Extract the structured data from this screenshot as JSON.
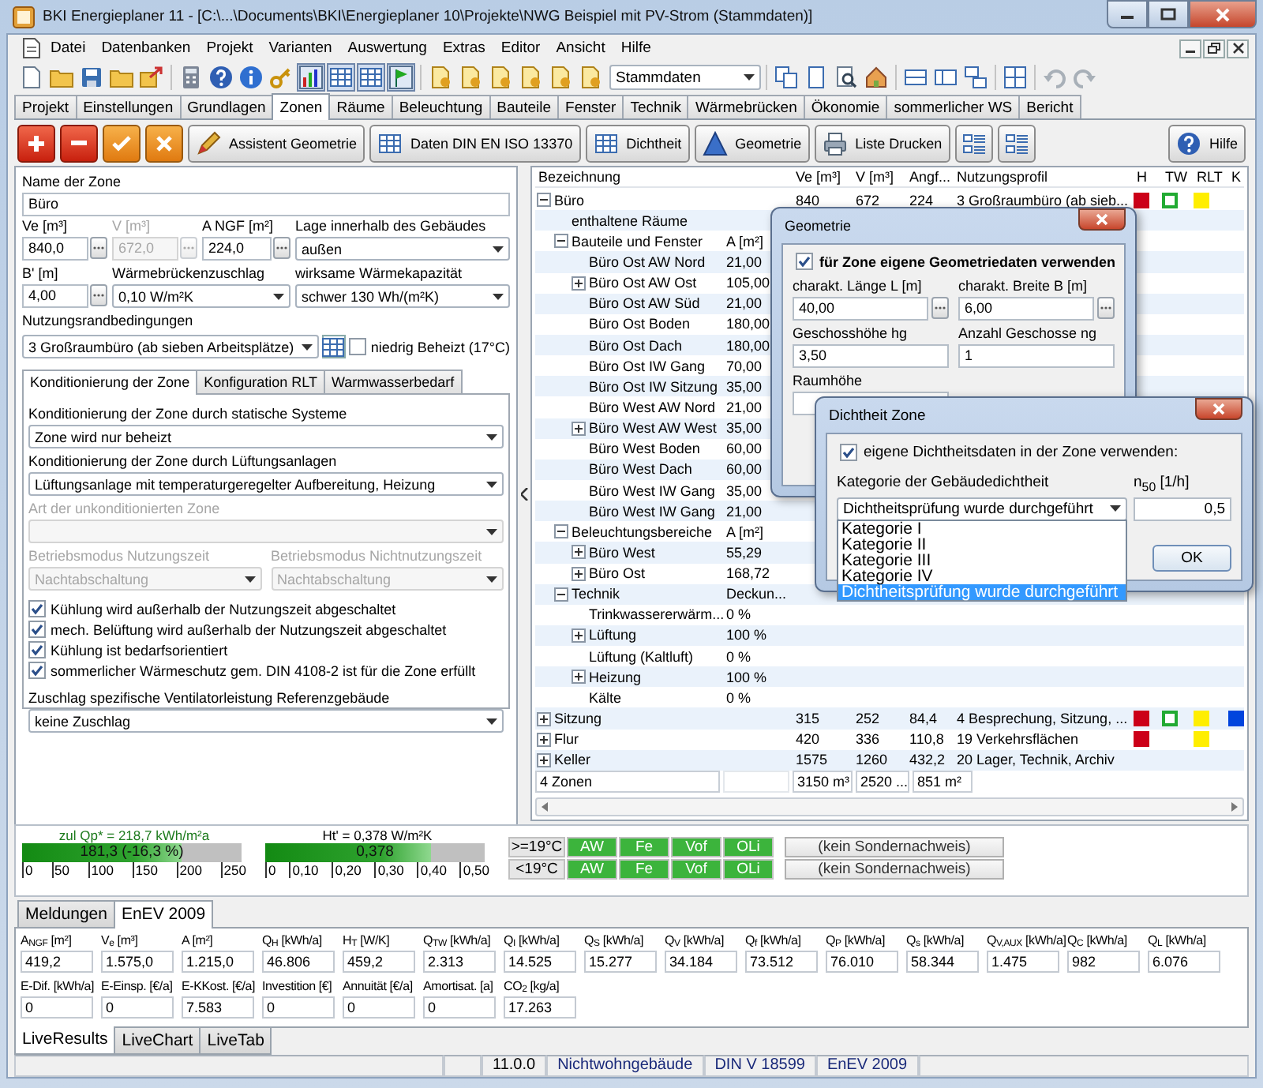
{
  "window": {
    "title": "BKI Energieplaner 11 - [C:\\...\\Documents\\BKI\\Energieplaner 10\\Projekte\\NWG Beispiel mit PV-Strom (Stammdaten)]"
  },
  "menu": [
    "Datei",
    "Datenbanken",
    "Projekt",
    "Varianten",
    "Auswertung",
    "Extras",
    "Editor",
    "Ansicht",
    "Hilfe"
  ],
  "toolbar": {
    "variant_select": "Stammdaten"
  },
  "tabs": [
    {
      "label": "Projekt",
      "selected": false
    },
    {
      "label": "Einstellungen",
      "selected": false
    },
    {
      "label": "Grundlagen",
      "selected": false
    },
    {
      "label": "Zonen",
      "selected": true
    },
    {
      "label": "Räume",
      "selected": false
    },
    {
      "label": "Beleuchtung",
      "selected": false
    },
    {
      "label": "Bauteile",
      "selected": false
    },
    {
      "label": "Fenster",
      "selected": false
    },
    {
      "label": "Technik",
      "selected": false
    },
    {
      "label": "Wärmebrücken",
      "selected": false
    },
    {
      "label": "Ökonomie",
      "selected": false
    },
    {
      "label": "sommerlicher WS",
      "selected": false
    },
    {
      "label": "Bericht",
      "selected": false
    }
  ],
  "zone_toolbar": [
    {
      "kind": "add"
    },
    {
      "kind": "remove"
    },
    {
      "kind": "accept"
    },
    {
      "kind": "cancel"
    },
    {
      "kind": "wizard",
      "label": "Assistent Geometrie"
    },
    {
      "kind": "table",
      "label": "Daten DIN EN ISO 13370"
    },
    {
      "kind": "table",
      "label": "Dichtheit"
    },
    {
      "kind": "shape",
      "label": "Geometrie"
    },
    {
      "kind": "print",
      "label": "Liste Drucken"
    },
    {
      "kind": "list"
    },
    {
      "kind": "list"
    },
    {
      "kind": "help",
      "label": "Hilfe"
    }
  ],
  "zone_form": {
    "name": {
      "label": "Name der Zone",
      "value": "Büro"
    },
    "row_a": [
      {
        "label": "Ve [m³]",
        "value": "840,0",
        "kind": "number",
        "disabled": false
      },
      {
        "label": "V [m³]",
        "value": "672,0",
        "kind": "number",
        "disabled": true
      },
      {
        "label": "A NGF [m²]",
        "value": "224,0",
        "kind": "number",
        "disabled": false
      },
      {
        "label": "Lage innerhalb des Gebäudes",
        "value": "außen",
        "kind": "select",
        "disabled": false
      }
    ],
    "row_b": [
      {
        "label": "B' [m]",
        "value": "4,00",
        "kind": "number",
        "disabled": false
      },
      {
        "label": "Wärmebrückenzuschlag",
        "value": "0,10 W/m²K",
        "kind": "select",
        "disabled": false
      },
      {
        "label": "wirksame Wärmekapazität",
        "value": "schwer 130 Wh/(m²K)",
        "kind": "select",
        "disabled": false
      }
    ],
    "usage": {
      "label": "Nutzungsrandbedingungen",
      "value": "3 Großraumbüro (ab sieben Arbeitsplätze)",
      "low_heat": {
        "label": "niedrig Beheizt (17°C)",
        "checked": false
      }
    },
    "subtabs": [
      {
        "label": "Konditionierung der Zone",
        "selected": true
      },
      {
        "label": "Konfiguration RLT",
        "selected": false
      },
      {
        "label": "Warmwasserbedarf",
        "selected": false
      }
    ],
    "conditioning": [
      {
        "kind": "select",
        "label": "Konditionierung der Zone durch statische Systeme",
        "value": "Zone wird nur beheizt",
        "disabled": false
      },
      {
        "kind": "select",
        "label": "Konditionierung der Zone durch Lüftungsanlagen",
        "value": "Lüftungsanlage mit temperaturgeregelter Aufbereitung, Heizung",
        "disabled": false
      },
      {
        "kind": "select",
        "label": "Art der unkonditionierten Zone",
        "disabled": true
      },
      {
        "kind": "pair",
        "items": [
          {
            "label": "Betriebsmodus Nutzungszeit",
            "value": "Nachtabschaltung",
            "disabled": true
          },
          {
            "label": "Betriebsmodus Nichtnutzungszeit",
            "value": "Nachtabschaltung",
            "disabled": true
          }
        ]
      },
      {
        "kind": "checkbox",
        "label": "Kühlung wird außerhalb der Nutzungszeit abgeschaltet",
        "checked": true
      },
      {
        "kind": "checkbox",
        "label": "mech. Belüftung wird außerhalb der Nutzungszeit abgeschaltet",
        "checked": true
      },
      {
        "kind": "checkbox",
        "label": "Kühlung ist bedarfsorientiert",
        "checked": true
      },
      {
        "kind": "checkbox",
        "label": "sommerlicher Wärmeschutz gem. DIN 4108-2 ist für die Zone erfüllt",
        "checked": true
      },
      {
        "kind": "select",
        "label": "Zuschlag spezifische Ventilatorleistung Referenzgebäude",
        "value": "keine Zuschlag",
        "disabled": false
      }
    ]
  },
  "tree": {
    "columns": [
      {
        "title": "Bezeichnung",
        "kind": "label"
      },
      {
        "kind": "text"
      },
      {
        "title": "Ve [m³]",
        "kind": "text"
      },
      {
        "title": "V [m³]",
        "kind": "text"
      },
      {
        "title": "Angf...",
        "kind": "text"
      },
      {
        "title": "Nutzungsprofil",
        "kind": "text"
      },
      {
        "title": "H",
        "kind": "marker"
      },
      {
        "title": "TW",
        "kind": "marker"
      },
      {
        "title": "RLT",
        "kind": "marker"
      },
      {
        "title": "K",
        "kind": "marker"
      }
    ],
    "rows": [
      {
        "expanded": true,
        "cells": [
          "Büro",
          "",
          "840",
          "672",
          "224",
          "3 Großraumbüro (ab sieb..."
        ],
        "markers": {
          "h": {
            "color": "#cc0018",
            "kind": "solid"
          },
          "tw": {
            "color": "#22aa33",
            "kind": "hollow"
          },
          "rlt": {
            "color": "#ffee00",
            "kind": "solid"
          }
        },
        "children": [
          {
            "cells": [
              "enthaltene Räume"
            ]
          },
          {
            "cells": [
              "Bauteile und Fenster",
              "A [m²]"
            ],
            "expanded": true,
            "children": [
              {
                "cells": [
                  "Büro Ost AW Nord",
                  "21,00"
                ]
              },
              {
                "cells": [
                  "Büro Ost AW Ost",
                  "105,00"
                ],
                "expanded": false
              },
              {
                "cells": [
                  "Büro Ost AW Süd",
                  "21,00"
                ]
              },
              {
                "cells": [
                  "Büro Ost Boden",
                  "180,00"
                ]
              },
              {
                "cells": [
                  "Büro Ost Dach",
                  "180,00"
                ]
              },
              {
                "cells": [
                  "Büro Ost IW Gang",
                  "70,00"
                ]
              },
              {
                "cells": [
                  "Büro Ost IW Sitzung",
                  "35,00"
                ]
              },
              {
                "cells": [
                  "Büro West AW Nord",
                  "21,00"
                ]
              },
              {
                "cells": [
                  "Büro West AW West",
                  "35,00"
                ],
                "expanded": false
              },
              {
                "cells": [
                  "Büro West Boden",
                  "60,00"
                ]
              },
              {
                "cells": [
                  "Büro West Dach",
                  "60,00"
                ]
              },
              {
                "cells": [
                  "Büro West IW Gang",
                  "35,00"
                ]
              },
              {
                "cells": [
                  "Büro West IW Gang",
                  "21,00"
                ]
              }
            ]
          },
          {
            "cells": [
              "Beleuchtungsbereiche",
              "A [m²]"
            ],
            "expanded": true,
            "children": [
              {
                "cells": [
                  "Büro West",
                  "55,29"
                ],
                "expanded": false
              },
              {
                "cells": [
                  "Büro Ost",
                  "168,72"
                ],
                "expanded": false
              }
            ]
          },
          {
            "cells": [
              "Technik",
              "Deckun..."
            ],
            "expanded": true,
            "children": [
              {
                "cells": [
                  "Trinkwassererwärm...",
                  "0 %"
                ]
              },
              {
                "cells": [
                  "Lüftung",
                  "100 %"
                ],
                "expanded": false
              },
              {
                "cells": [
                  "Lüftung (Kaltluft)",
                  "0 %"
                ]
              },
              {
                "cells": [
                  "Heizung",
                  "100 %"
                ],
                "expanded": false
              },
              {
                "cells": [
                  "Kälte",
                  "0 %"
                ]
              }
            ]
          }
        ]
      },
      {
        "expanded": false,
        "cells": [
          "Sitzung",
          "",
          "315",
          "252",
          "84,4",
          "4 Besprechung, Sitzung, ..."
        ],
        "markers": {
          "h": {
            "color": "#cc0018",
            "kind": "solid"
          },
          "tw": {
            "color": "#22aa33",
            "kind": "hollow"
          },
          "rlt": {
            "color": "#ffee00",
            "kind": "solid"
          },
          "k": {
            "color": "#0044dd",
            "kind": "solid"
          }
        }
      },
      {
        "expanded": false,
        "cells": [
          "Flur",
          "",
          "420",
          "336",
          "110,8",
          "19 Verkehrsflächen"
        ],
        "markers": {
          "h": {
            "color": "#cc0018",
            "kind": "solid"
          },
          "rlt": {
            "color": "#ffee00",
            "kind": "solid"
          }
        }
      },
      {
        "expanded": false,
        "cells": [
          "Keller",
          "",
          "1575",
          "1260",
          "432,2",
          "20 Lager, Technik, Archiv"
        ]
      }
    ],
    "footer": {
      "label": "4 Zonen",
      "totals": [
        "3150 m³",
        "2520 ...",
        "851 m²"
      ]
    }
  },
  "geometry_dialog": {
    "title": "Geometrie",
    "own_data": {
      "label": "für Zone eigene Geometriedaten verwenden",
      "checked": true
    },
    "fields": [
      {
        "label": "charakt. Länge L [m]",
        "value": "40,00",
        "kind": "picker"
      },
      {
        "label": "charakt. Breite B [m]",
        "value": "6,00",
        "kind": "picker"
      },
      {
        "label": "Geschosshöhe hg",
        "value": "3,50",
        "kind": "text"
      },
      {
        "label": "Anzahl Geschosse ng",
        "value": "1",
        "kind": "text"
      },
      {
        "label": "Raumhöhe",
        "kind": "text"
      }
    ]
  },
  "tightness_dialog": {
    "title": "Dichtheit Zone",
    "own_data": {
      "label": "eigene Dichtheitsdaten in der Zone verwenden:",
      "checked": true
    },
    "category_label": "Kategorie der Gebäudedichtheit",
    "category_value": "Dichtheitsprüfung wurde durchgeführt",
    "options": [
      {
        "label": "Kategorie I",
        "selected": false
      },
      {
        "label": "Kategorie II",
        "selected": false
      },
      {
        "label": "Kategorie III",
        "selected": false
      },
      {
        "label": "Kategorie IV",
        "selected": false
      },
      {
        "label": "Dichtheitsprüfung wurde durchgeführt",
        "selected": true
      }
    ],
    "n50_label": "n$_{50}$  [1/h]",
    "n50_value": "0,5",
    "ok": "OK"
  },
  "gauges": [
    {
      "caption": "zul Qp* = 218,7 kWh/m²a",
      "reading": "181,3 (-16,3 %)",
      "level": 0.725,
      "ticks": [
        "0",
        "50",
        "100",
        "150",
        "200",
        "250"
      ]
    },
    {
      "caption": "Ht' = 0,378 W/m²K",
      "reading": "0,378",
      "level": 0.756,
      "ticks": [
        "0",
        "0,10",
        "0,20",
        "0,30",
        "0,40",
        "0,50"
      ]
    }
  ],
  "checks": [
    {
      "label": ">=19°C",
      "cells": [
        {
          "label": "AW",
          "passed": true
        },
        {
          "label": "Fe",
          "passed": true
        },
        {
          "label": "Vof",
          "passed": true
        },
        {
          "label": "OLi",
          "passed": true
        }
      ],
      "proof": "(kein Sondernachweis)"
    },
    {
      "label": "<19°C",
      "cells": [
        {
          "label": "AW",
          "passed": true
        },
        {
          "label": "Fe",
          "passed": true
        },
        {
          "label": "Vof",
          "passed": true
        },
        {
          "label": "OLi",
          "passed": true
        }
      ],
      "proof": "(kein Sondernachweis)"
    }
  ],
  "result_tabs": [
    {
      "label": "Meldungen",
      "selected": false
    },
    {
      "label": "EnEV 2009",
      "selected": true
    }
  ],
  "results": [
    [
      {
        "label": "A$_{NGF}$ [m²]",
        "value": "419,2"
      },
      {
        "label": "V$_{e}$ [m³]",
        "value": "1.575,0"
      },
      {
        "label": "A [m²]",
        "value": "1.215,0"
      },
      {
        "label": "Q$_{H}$ [kWh/a]",
        "value": "46.806"
      },
      {
        "label": "H$_{T}$ [W/K]",
        "value": "459,2"
      },
      {
        "label": "Q$_{TW}$ [kWh/a]",
        "value": "2.313"
      },
      {
        "label": "Q$_{I}$ [kWh/a]",
        "value": "14.525"
      },
      {
        "label": "Q$_{S}$ [kWh/a]",
        "value": "15.277"
      },
      {
        "label": "Q$_{V}$ [kWh/a]",
        "value": "34.184"
      },
      {
        "label": "Q$_{f}$ [kWh/a]",
        "value": "73.512"
      },
      {
        "label": "Q$_{P}$ [kWh/a]",
        "value": "76.010"
      },
      {
        "label": "Q$_{s}$ [kWh/a]",
        "value": "58.344"
      },
      {
        "label": "Q$_{V,AUX}$ [kWh/a]",
        "value": "1.475"
      },
      {
        "label": "Q$_{C}$ [kWh/a]",
        "value": "982"
      },
      {
        "label": "Q$_{L}$ [kWh/a]",
        "value": "6.076"
      }
    ],
    [
      {
        "label": "E-Dif. [kWh/a]",
        "value": "0"
      },
      {
        "label": "E-Einsp. [€/a]",
        "value": "0"
      },
      {
        "label": "E-KKost. [€/a]",
        "value": "7.583"
      },
      {
        "label": "Investition [€]",
        "value": "0"
      },
      {
        "label": "Annuität [€/a]",
        "value": "0"
      },
      {
        "label": "Amortisat. [a]",
        "value": "0"
      },
      {
        "label": "CO$_{2}$ [kg/a]",
        "value": "17.263"
      }
    ]
  ],
  "view_tabs": [
    {
      "label": "LiveResults",
      "selected": true
    },
    {
      "label": "LiveChart",
      "selected": false
    },
    {
      "label": "LiveTab",
      "selected": false
    }
  ],
  "status_bar": [
    "11.0.0",
    "Nichtwohngebäude",
    "DIN V 18599",
    "EnEV 2009"
  ]
}
